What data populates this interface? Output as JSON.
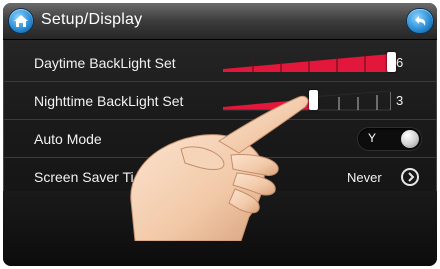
{
  "header": {
    "title": "Setup/Display",
    "home_icon": "home-icon",
    "back_icon": "back-arrow-icon"
  },
  "settings": {
    "daytime": {
      "label": "Daytime BackLight Set",
      "value": "6",
      "level_fraction": 1.0
    },
    "nighttime": {
      "label": "Nighttime BackLight Set",
      "value": "3",
      "level_fraction": 0.5
    },
    "auto_mode": {
      "label": "Auto Mode",
      "value": "Y"
    },
    "screen_saver": {
      "label": "Screen Saver Ti",
      "value": "Never",
      "icon": "chevron-right-icon"
    }
  },
  "colors": {
    "accent_red": "#e3173b",
    "home_blue": "#2b8fd8"
  }
}
